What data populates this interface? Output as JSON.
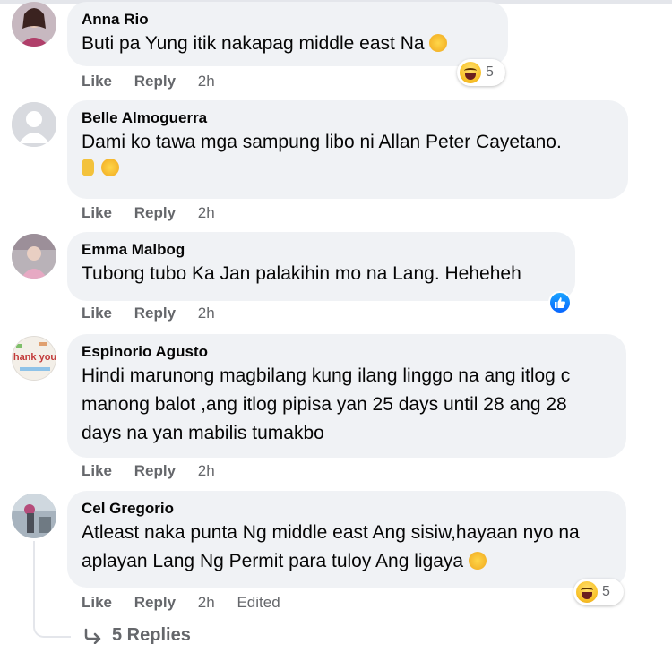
{
  "comments": [
    {
      "name": "Anna Rio",
      "text": "Buti pa Yung itik nakapag middle east Na",
      "like_label": "Like",
      "reply_label": "Reply",
      "time": "2h",
      "reaction_count": "5"
    },
    {
      "name": "Belle Almoguerra",
      "text": "Dami ko tawa mga sampung libo ni Allan Peter Cayetano.",
      "like_label": "Like",
      "reply_label": "Reply",
      "time": "2h"
    },
    {
      "name": "Emma Malbog",
      "text": "Tubong tubo Ka Jan palakihin mo na Lang. Heheheh",
      "like_label": "Like",
      "reply_label": "Reply",
      "time": "2h"
    },
    {
      "name": "Espinorio Agusto",
      "text": "Hindi marunong magbilang kung ilang linggo na ang itlog c manong balot ,ang itlog pipisa yan 25 days until 28 ang 28 days na yan mabilis tumakbo",
      "like_label": "Like",
      "reply_label": "Reply",
      "time": "2h",
      "avatar_text": "hank you"
    },
    {
      "name": "Cel Gregorio",
      "text": "Atleast naka punta Ng middle east Ang sisiw,hayaan nyo na aplayan Lang Ng Permit para tuloy Ang ligaya",
      "like_label": "Like",
      "reply_label": "Reply",
      "time": "2h",
      "edited_label": "Edited",
      "reaction_count": "5"
    }
  ],
  "replies_label": "5 Replies",
  "colors": {
    "bubble": "#f0f2f5",
    "secondary_text": "#65676b",
    "like_blue": "#0866ff",
    "haha_yellow": "#f9c42c"
  },
  "icons": [
    "haha-reaction-icon",
    "like-reaction-icon",
    "victory-hand-emoji",
    "rolling-laughing-emoji",
    "smiling-emoji",
    "reply-arrow-icon"
  ]
}
